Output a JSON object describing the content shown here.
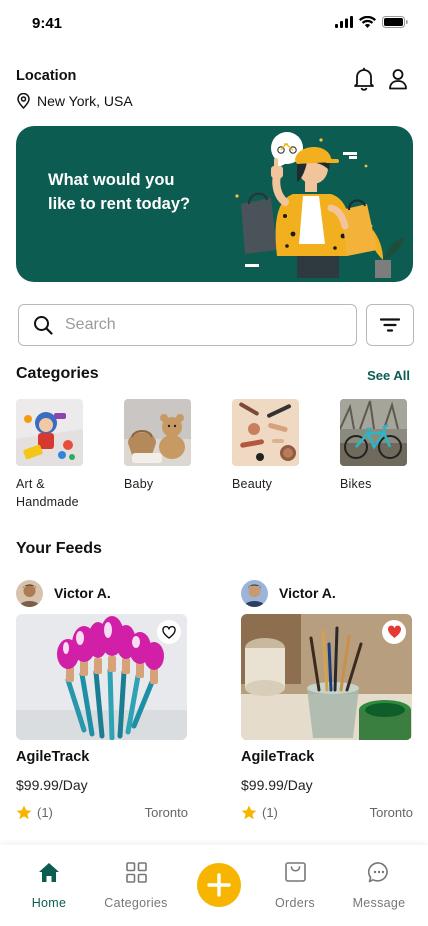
{
  "status": {
    "time": "9:41"
  },
  "location": {
    "title": "Location",
    "value": "New York, USA"
  },
  "banner": {
    "text": "What would you like to rent today?"
  },
  "search": {
    "placeholder": "Search"
  },
  "categories": {
    "title": "Categories",
    "see_all": "See All",
    "items": [
      {
        "label": "Art & Handmade"
      },
      {
        "label": "Baby"
      },
      {
        "label": "Beauty"
      },
      {
        "label": "Bikes"
      }
    ]
  },
  "feeds": {
    "title": "Your Feeds",
    "items": [
      {
        "user": "Victor A.",
        "title": "AgileTrack",
        "price": "$99.99/Day",
        "rating": "(1)",
        "city": "Toronto",
        "liked": false
      },
      {
        "user": "Victor A.",
        "title": "AgileTrack",
        "price": "$99.99/Day",
        "rating": "(1)",
        "city": "Toronto",
        "liked": true
      }
    ]
  },
  "tabs": [
    {
      "label": "Home",
      "icon": "home-icon",
      "active": true
    },
    {
      "label": "Categories",
      "icon": "grid-icon",
      "active": false
    },
    {
      "label": "",
      "icon": "plus-icon",
      "active": false
    },
    {
      "label": "Orders",
      "icon": "box-icon",
      "active": false
    },
    {
      "label": "Message",
      "icon": "chat-icon",
      "active": false
    }
  ],
  "colors": {
    "primary": "#0c5c52",
    "accent": "#f7b500",
    "heart": "#e53935"
  }
}
